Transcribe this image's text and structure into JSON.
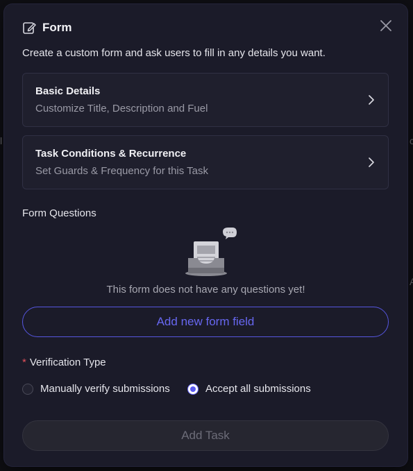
{
  "modal": {
    "title": "Form",
    "subtitle": "Create a custom form and ask users to fill in any details you want."
  },
  "cards": [
    {
      "title": "Basic Details",
      "subtitle": "Customize Title, Description and Fuel"
    },
    {
      "title": "Task Conditions & Recurrence",
      "subtitle": "Set Guards & Frequency for this Task"
    }
  ],
  "questions": {
    "label": "Form Questions",
    "empty_text": "This form does not have any questions yet!",
    "add_button": "Add new form field"
  },
  "verification": {
    "required_mark": "*",
    "label": "Verification Type",
    "options": [
      {
        "label": "Manually verify submissions",
        "selected": false
      },
      {
        "label": "Accept all submissions",
        "selected": true
      }
    ]
  },
  "submit_label": "Add Task",
  "colors": {
    "accent": "#5a5af0",
    "modal_bg": "#1b1b29",
    "required": "#e0505a"
  }
}
